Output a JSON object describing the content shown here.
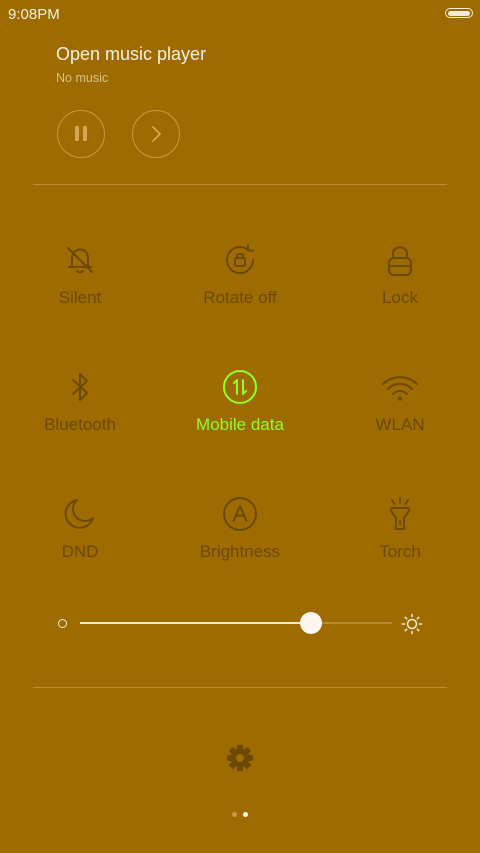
{
  "status_bar": {
    "time": "9:08PM"
  },
  "music": {
    "title": "Open music player",
    "subtitle": "No music"
  },
  "toggles": [
    {
      "label": "Silent",
      "icon": "bell-off-icon",
      "active": false
    },
    {
      "label": "Rotate off",
      "icon": "rotate-lock-icon",
      "active": false
    },
    {
      "label": "Lock",
      "icon": "lock-icon",
      "active": false
    },
    {
      "label": "Bluetooth",
      "icon": "bluetooth-icon",
      "active": false
    },
    {
      "label": "Mobile data",
      "icon": "mobile-data-icon",
      "active": true
    },
    {
      "label": "WLAN",
      "icon": "wifi-icon",
      "active": false
    },
    {
      "label": "DND",
      "icon": "moon-icon",
      "active": false
    },
    {
      "label": "Brightness",
      "icon": "auto-brightness-icon",
      "active": false
    },
    {
      "label": "Torch",
      "icon": "torch-icon",
      "active": false
    }
  ],
  "brightness": {
    "level": 0.74
  },
  "pager": {
    "current": 2,
    "total": 2
  },
  "colors": {
    "background": "#9e6b00",
    "icon_inactive": "#6b4a00",
    "active_accent": "#8eff1e"
  }
}
